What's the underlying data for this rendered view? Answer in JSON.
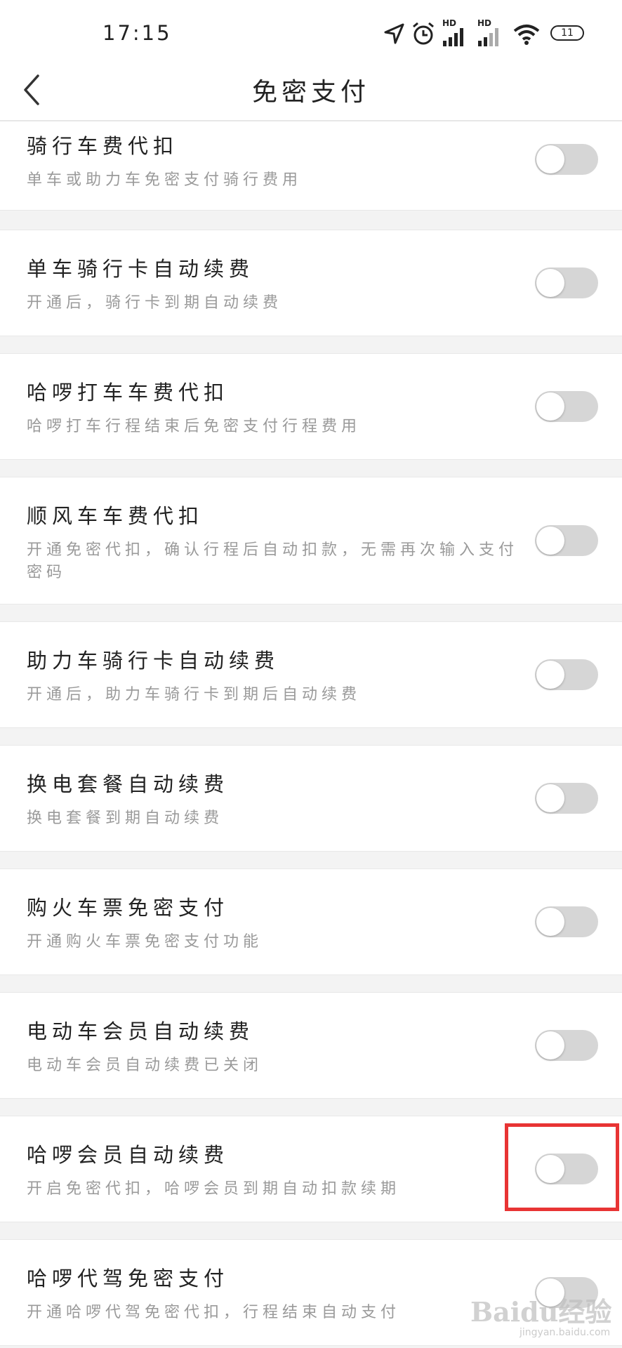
{
  "status_bar": {
    "time": "17:15",
    "hd1": "HD",
    "hd2": "HD",
    "battery": "11"
  },
  "header": {
    "title": "免密支付",
    "back_icon": "chevron-left-icon"
  },
  "items": [
    {
      "title": "骑行车费代扣",
      "subtitle": "单车或助力车免密支付骑行费用",
      "enabled": false
    },
    {
      "title": "单车骑行卡自动续费",
      "subtitle": "开通后，骑行卡到期自动续费",
      "enabled": false
    },
    {
      "title": "哈啰打车车费代扣",
      "subtitle": "哈啰打车行程结束后免密支付行程费用",
      "enabled": false
    },
    {
      "title": "顺风车车费代扣",
      "subtitle": "开通免密代扣，确认行程后自动扣款，无需再次输入支付密码",
      "enabled": false
    },
    {
      "title": "助力车骑行卡自动续费",
      "subtitle": "开通后，助力车骑行卡到期后自动续费",
      "enabled": false
    },
    {
      "title": "换电套餐自动续费",
      "subtitle": "换电套餐到期自动续费",
      "enabled": false
    },
    {
      "title": "购火车票免密支付",
      "subtitle": "开通购火车票免密支付功能",
      "enabled": false
    },
    {
      "title": "电动车会员自动续费",
      "subtitle": "电动车会员自动续费已关闭",
      "enabled": false
    },
    {
      "title": "哈啰会员自动续费",
      "subtitle": "开启免密代扣，哈啰会员到期自动扣款续期",
      "enabled": false
    },
    {
      "title": "哈啰代驾免密支付",
      "subtitle": "开通哈啰代驾免密代扣，行程结束自动支付",
      "enabled": false
    }
  ],
  "watermark": {
    "text": "Baidu经验",
    "url": "jingyan.baidu.com"
  },
  "colors": {
    "toggle_off": "#d6d6d6",
    "highlight": "#e83434"
  }
}
